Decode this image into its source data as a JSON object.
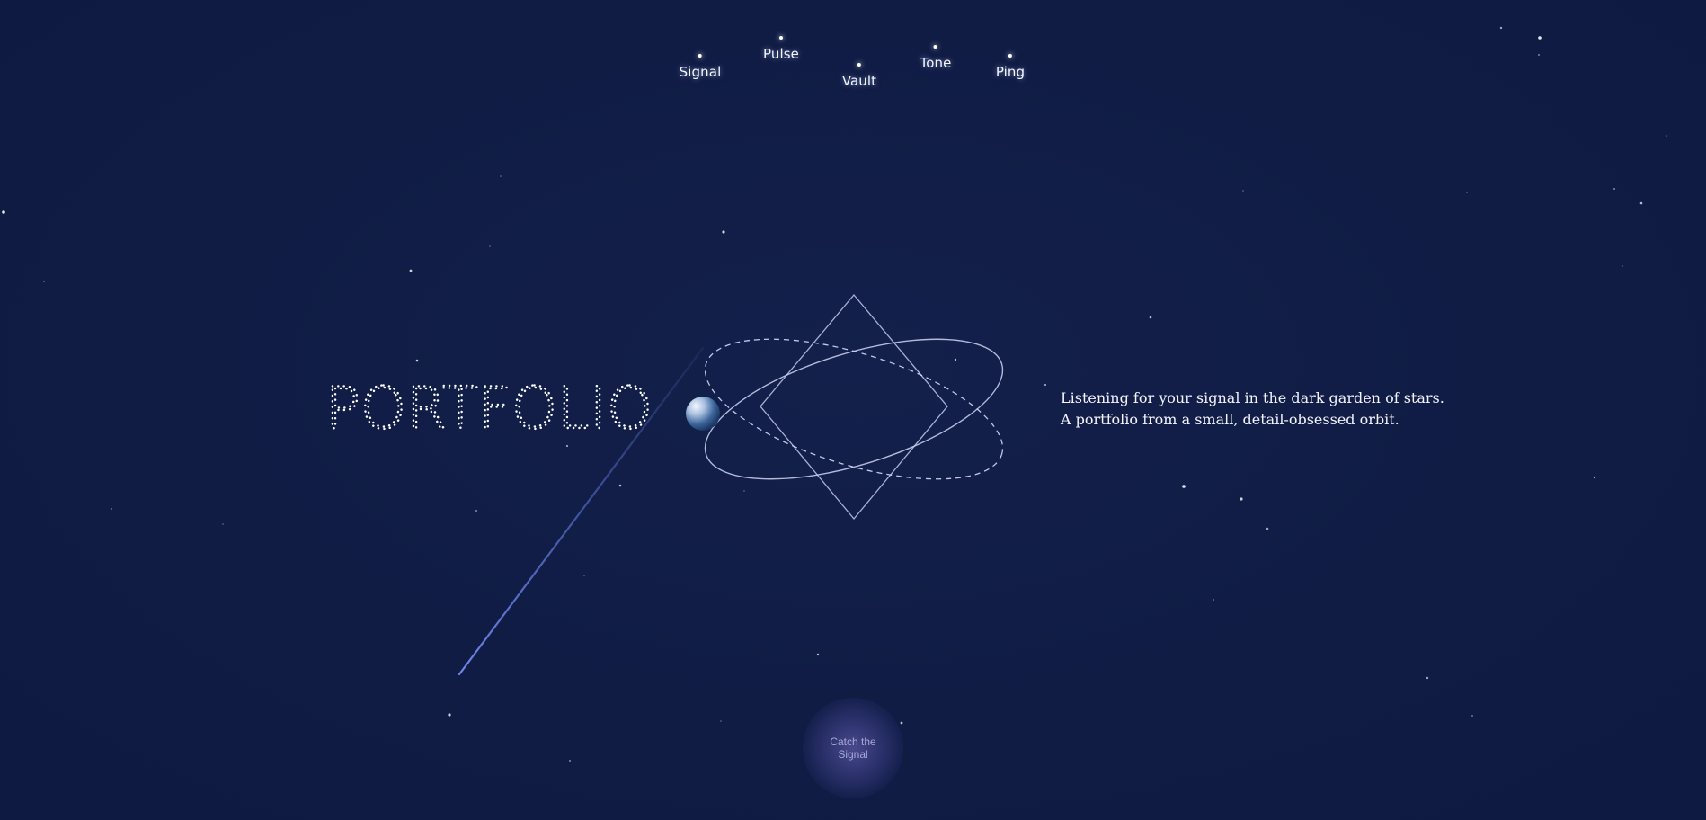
{
  "nav": {
    "items": [
      {
        "label": "Signal"
      },
      {
        "label": "Pulse"
      },
      {
        "label": "Vault"
      },
      {
        "label": "Tone"
      },
      {
        "label": "Ping"
      }
    ]
  },
  "hero": {
    "title": "PORTFOLIO",
    "tagline_line1": "Listening for your signal in the dark garden of stars.",
    "tagline_line2": "A portfolio from a small, detail-obsessed orbit."
  },
  "cta": {
    "label": "Catch the Signal"
  },
  "colors": {
    "background": "#111c44",
    "star": "#ffffff",
    "orbit_line": "#c9cdf0",
    "comet_trail": "#6f87e6",
    "planet_light": "#dfe9f7",
    "planet_dark": "#2b4f86",
    "button_glow": "#7b72c8"
  },
  "icons": {
    "planet": "planet-icon",
    "orbit_graphic": "orbit-star-icon",
    "comet": "comet-trail-icon"
  }
}
